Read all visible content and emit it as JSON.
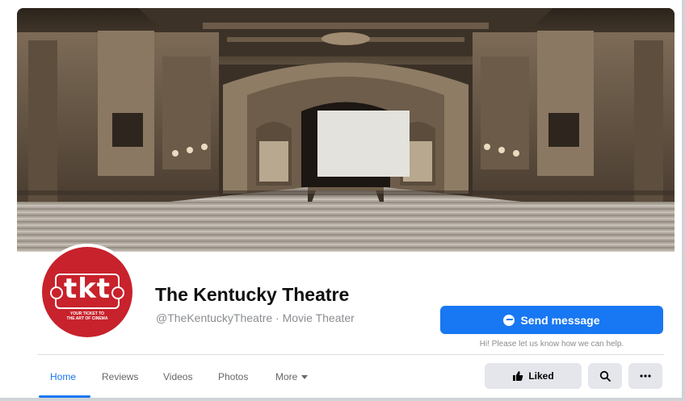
{
  "page": {
    "title": "The Kentucky Theatre",
    "subtitle": "@TheKentuckyTheatre · Movie Theater"
  },
  "logo": {
    "text": "tkt",
    "tagline_line1": "YOUR TICKET TO",
    "tagline_line2": "THE ART OF CINEMA"
  },
  "actions": {
    "send_message_label": "Send message",
    "send_message_icon": "messenger-icon",
    "helper_text": "Hi! Please let us know how we can help.",
    "liked_label": "Liked",
    "liked_icon": "thumbs-up-icon",
    "search_icon": "search-icon",
    "more_icon": "ellipsis-icon"
  },
  "nav": {
    "tabs": [
      {
        "label": "Home",
        "active": true
      },
      {
        "label": "Reviews",
        "active": false
      },
      {
        "label": "Videos",
        "active": false
      },
      {
        "label": "Photos",
        "active": false
      },
      {
        "label": "More",
        "active": false
      }
    ]
  },
  "colors": {
    "accent": "#1877f2",
    "logo_red": "#c8222c",
    "button_gray": "#e4e6eb",
    "muted_text": "#8a8d91"
  }
}
